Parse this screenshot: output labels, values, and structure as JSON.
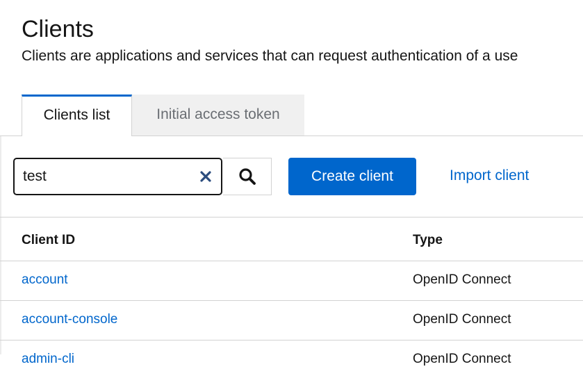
{
  "header": {
    "title": "Clients",
    "description": "Clients are applications and services that can request authentication of a use"
  },
  "tabs": [
    {
      "label": "Clients list",
      "active": true
    },
    {
      "label": "Initial access token",
      "active": false
    }
  ],
  "toolbar": {
    "search_value": "test",
    "create_label": "Create client",
    "import_label": "Import client"
  },
  "table": {
    "columns": [
      "Client ID",
      "Type"
    ],
    "rows": [
      {
        "client_id": "account",
        "type": "OpenID Connect"
      },
      {
        "client_id": "account-console",
        "type": "OpenID Connect"
      },
      {
        "client_id": "admin-cli",
        "type": "OpenID Connect"
      }
    ]
  },
  "colors": {
    "accent": "#0066cc",
    "border": "#d2d2d2",
    "text": "#151515",
    "muted": "#6a6e73"
  }
}
